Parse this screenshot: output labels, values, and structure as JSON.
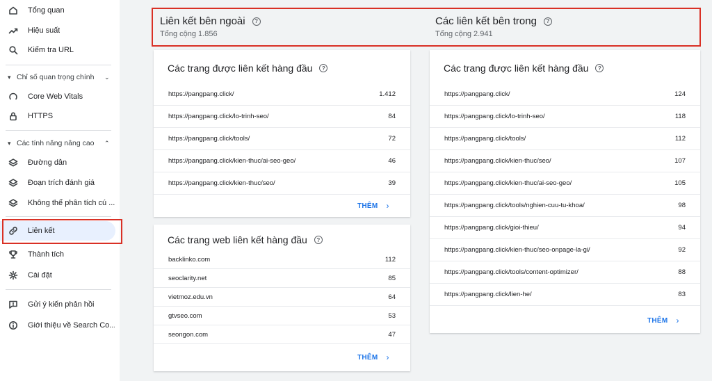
{
  "sidebar": {
    "items_top": [
      {
        "label": "Tổng quan",
        "icon": "home-icon"
      },
      {
        "label": "Hiệu suất",
        "icon": "trending-up-icon"
      },
      {
        "label": "Kiểm tra URL",
        "icon": "search-icon"
      }
    ],
    "section1": {
      "label": "Chỉ số quan trọng chính"
    },
    "items_mid": [
      {
        "label": "Core Web Vitals",
        "icon": "gauge-icon"
      },
      {
        "label": "HTTPS",
        "icon": "lock-icon"
      }
    ],
    "section2": {
      "label": "Các tính năng nâng cao"
    },
    "items_adv": [
      {
        "label": "Đường dẫn",
        "icon": "layers-icon"
      },
      {
        "label": "Đoạn trích đánh giá",
        "icon": "layers-icon"
      },
      {
        "label": "Không thể phân tích cú ...",
        "icon": "layers-icon"
      }
    ],
    "items_links": [
      {
        "label": "Liên kết",
        "icon": "link-icon"
      },
      {
        "label": "Thành tích",
        "icon": "trophy-icon"
      },
      {
        "label": "Cài đặt",
        "icon": "gear-icon"
      }
    ],
    "items_bottom": [
      {
        "label": "Gửi ý kiến phản hồi",
        "icon": "feedback-icon"
      },
      {
        "label": "Giới thiệu về Search Co...",
        "icon": "info-icon"
      }
    ]
  },
  "summary": {
    "external": {
      "title": "Liên kết bên ngoài",
      "total": "Tổng cộng 1.856"
    },
    "internal": {
      "title": "Các liên kết bên trong",
      "total": "Tổng cộng 2.941"
    }
  },
  "external_top_pages": {
    "title": "Các trang được liên kết hàng đầu",
    "rows": [
      {
        "url": "https://pangpang.click/",
        "count": "1.412"
      },
      {
        "url": "https://pangpang.click/lo-trinh-seo/",
        "count": "84"
      },
      {
        "url": "https://pangpang.click/tools/",
        "count": "72"
      },
      {
        "url": "https://pangpang.click/kien-thuc/ai-seo-geo/",
        "count": "46"
      },
      {
        "url": "https://pangpang.click/kien-thuc/seo/",
        "count": "39"
      }
    ],
    "more": "THÊM"
  },
  "top_linking_sites": {
    "title": "Các trang web liên kết hàng đầu",
    "rows": [
      {
        "url": "backlinko.com",
        "count": "112"
      },
      {
        "url": "seoclarity.net",
        "count": "85"
      },
      {
        "url": "vietmoz.edu.vn",
        "count": "64"
      },
      {
        "url": "gtvseo.com",
        "count": "53"
      },
      {
        "url": "seongon.com",
        "count": "47"
      }
    ],
    "more": "THÊM"
  },
  "internal_top_pages": {
    "title": "Các trang được liên kết hàng đầu",
    "rows": [
      {
        "url": "https://pangpang.click/",
        "count": "124"
      },
      {
        "url": "https://pangpang.click/lo-trinh-seo/",
        "count": "118"
      },
      {
        "url": "https://pangpang.click/tools/",
        "count": "112"
      },
      {
        "url": "https://pangpang.click/kien-thuc/seo/",
        "count": "107"
      },
      {
        "url": "https://pangpang.click/kien-thuc/ai-seo-geo/",
        "count": "105"
      },
      {
        "url": "https://pangpang.click/tools/nghien-cuu-tu-khoa/",
        "count": "98"
      },
      {
        "url": "https://pangpang.click/gioi-thieu/",
        "count": "94"
      },
      {
        "url": "https://pangpang.click/kien-thuc/seo-onpage-la-gi/",
        "count": "92"
      },
      {
        "url": "https://pangpang.click/tools/content-optimizer/",
        "count": "88"
      },
      {
        "url": "https://pangpang.click/lien-he/",
        "count": "83"
      }
    ],
    "more": "THÊM"
  },
  "colors": {
    "accent": "#1a73e8",
    "highlight": "#d93025",
    "active_bg": "#e8f0fe"
  }
}
